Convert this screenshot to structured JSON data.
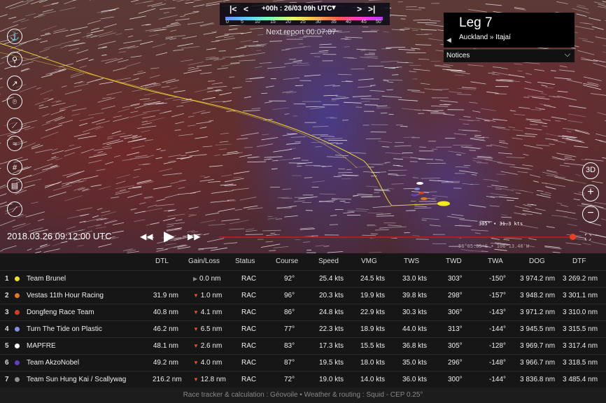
{
  "timebar": {
    "time_label": "+00h : 26/03 09h UTC",
    "scale_ticks": [
      "0",
      "5",
      "10",
      "15",
      "20",
      "25",
      "30",
      "35",
      "40",
      "45",
      "50"
    ]
  },
  "next_report": "Next report 00:07:07",
  "leg": {
    "title": "Leg 7",
    "route": "Auckland » Itajaí",
    "notices_label": "Notices"
  },
  "map": {
    "datetime": "2018.03.26 09:12:00 UTC",
    "wind_readout": "305° • 31.3 kts",
    "coordinates": "56°05.85'S • 106°13.46'W",
    "right_tools": [
      "3D"
    ]
  },
  "table": {
    "columns": [
      "DTL",
      "Gain/Loss",
      "Status",
      "Course",
      "Speed",
      "VMG",
      "TWS",
      "TWD",
      "TWA",
      "DOG",
      "DTF"
    ],
    "rows": [
      {
        "rank": "1",
        "team": "Team Brunel",
        "color": "#f0e020",
        "dtl": "",
        "gain": "0.0 nm",
        "lead": true,
        "status": "RAC",
        "course": "92°",
        "speed": "25.4 kts",
        "vmg": "24.5 kts",
        "tws": "33.0 kts",
        "twd": "303°",
        "twa": "-150°",
        "dog": "3 974.2 nm",
        "dtf": "3 269.2 nm"
      },
      {
        "rank": "2",
        "team": "Vestas 11th Hour Racing",
        "color": "#e07820",
        "dtl": "31.9 nm",
        "gain": "1.0 nm",
        "lead": false,
        "status": "RAC",
        "course": "96°",
        "speed": "20.3 kts",
        "vmg": "19.9 kts",
        "tws": "39.8 kts",
        "twd": "298°",
        "twa": "-157°",
        "dog": "3 948.2 nm",
        "dtf": "3 301.1 nm"
      },
      {
        "rank": "3",
        "team": "Dongfeng Race Team",
        "color": "#d04020",
        "dtl": "40.8 nm",
        "gain": "4.1 nm",
        "lead": false,
        "status": "RAC",
        "course": "86°",
        "speed": "24.8 kts",
        "vmg": "22.9 kts",
        "tws": "30.3 kts",
        "twd": "306°",
        "twa": "-143°",
        "dog": "3 971.2 nm",
        "dtf": "3 310.0 nm"
      },
      {
        "rank": "4",
        "team": "Turn The Tide on Plastic",
        "color": "#8090e0",
        "dtl": "46.2 nm",
        "gain": "6.5 nm",
        "lead": false,
        "status": "RAC",
        "course": "77°",
        "speed": "22.3 kts",
        "vmg": "18.9 kts",
        "tws": "44.0 kts",
        "twd": "313°",
        "twa": "-144°",
        "dog": "3 945.5 nm",
        "dtf": "3 315.5 nm"
      },
      {
        "rank": "5",
        "team": "MAPFRE",
        "color": "#ffffff",
        "dtl": "48.1 nm",
        "gain": "2.6 nm",
        "lead": false,
        "status": "RAC",
        "course": "83°",
        "speed": "17.3 kts",
        "vmg": "15.5 kts",
        "tws": "36.8 kts",
        "twd": "305°",
        "twa": "-128°",
        "dog": "3 969.7 nm",
        "dtf": "3 317.4 nm"
      },
      {
        "rank": "6",
        "team": "Team AkzoNobel",
        "color": "#6040c0",
        "dtl": "49.2 nm",
        "gain": "4.0 nm",
        "lead": false,
        "status": "RAC",
        "course": "87°",
        "speed": "19.5 kts",
        "vmg": "18.0 kts",
        "tws": "35.0 kts",
        "twd": "296°",
        "twa": "-148°",
        "dog": "3 966.7 nm",
        "dtf": "3 318.5 nm"
      },
      {
        "rank": "7",
        "team": "Team Sun Hung Kai / Scallywag",
        "color": "#909090",
        "dtl": "216.2 nm",
        "gain": "12.8 nm",
        "lead": false,
        "status": "RAC",
        "course": "72°",
        "speed": "19.0 kts",
        "vmg": "14.0 kts",
        "tws": "36.0 kts",
        "twd": "300°",
        "twa": "-144°",
        "dog": "3 836.8 nm",
        "dtf": "3 485.4 nm"
      }
    ]
  },
  "footer": "Race tracker & calculation : Géovoile • Weather & routing : Squid - CEP 0.25°"
}
